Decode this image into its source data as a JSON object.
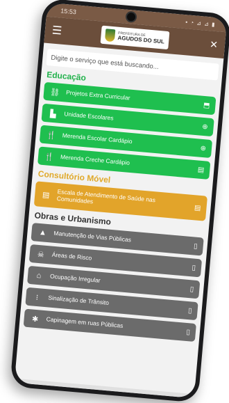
{
  "status": {
    "time": "15:53",
    "icons": "▪ ◔ ⊿ ⊿ ▮"
  },
  "header": {
    "logo_small": "PREFEITURA DE",
    "logo_big": "AGUDOS DO SUL"
  },
  "search": {
    "placeholder": "Digite o serviço que está buscando..."
  },
  "sections": {
    "educacao": {
      "title": "Educação",
      "items": [
        {
          "label": "Projetos Extra Curricular",
          "icon": "network-icon",
          "end": "expand-icon"
        },
        {
          "label": "Unidade Escolares",
          "icon": "school-icon",
          "end": "globe-icon"
        },
        {
          "label": "Merenda Escolar Cardápio",
          "icon": "cutlery-icon",
          "end": "globe-icon"
        },
        {
          "label": "Merenda Creche Cardápio",
          "icon": "cutlery-icon",
          "end": "document-icon"
        }
      ]
    },
    "consultorio": {
      "title": "Consultório Móvel",
      "items": [
        {
          "label": "Escala de Atendimento de Saúde nas Comunidades",
          "icon": "document-icon",
          "end": "document-icon"
        }
      ]
    },
    "obras": {
      "title": "Obras e Urbanismo",
      "items": [
        {
          "label": "Manutenção de Vias Públicas",
          "icon": "road-icon",
          "end": "clipboard-icon"
        },
        {
          "label": "Áreas de Risco",
          "icon": "skull-icon",
          "end": "clipboard-icon"
        },
        {
          "label": "Ocupação Irregular",
          "icon": "house-icon",
          "end": "clipboard-icon"
        },
        {
          "label": "Sinalização de Trânsito",
          "icon": "traffic-light-icon",
          "end": "clipboard-icon"
        },
        {
          "label": "Capinagem em ruas Públicas",
          "icon": "asterisk-icon",
          "end": "clipboard-icon"
        }
      ]
    }
  },
  "colors": {
    "green": "#1fbf4f",
    "orange": "#e2a42a",
    "gray": "#6b6b6b",
    "appbar": "#6b4e3b"
  }
}
